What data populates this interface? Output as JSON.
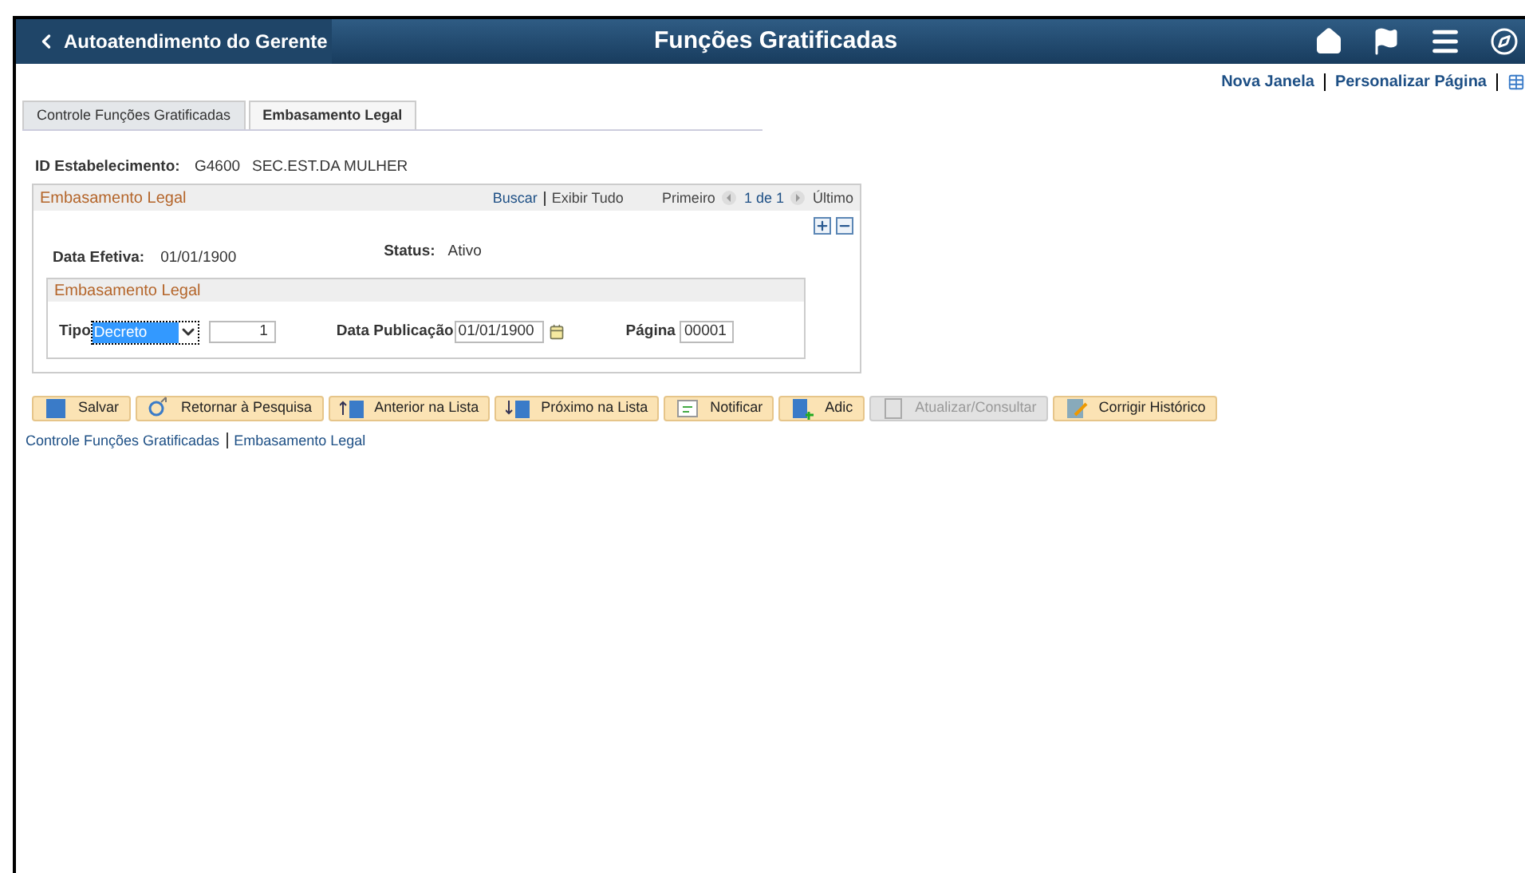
{
  "header": {
    "back_label": "Autoatendimento do Gerente",
    "title": "Funções Gratificadas"
  },
  "top_links": [
    "Nova Janela",
    "Personalizar Página"
  ],
  "tabs": [
    {
      "label": "Controle Funções Gratificadas",
      "selected": false
    },
    {
      "label": "Embasamento Legal",
      "selected": true
    }
  ],
  "establishment": {
    "label": "ID Estabelecimento:",
    "code": "G4600",
    "name": "SEC.EST.DA MULHER"
  },
  "section": {
    "title": "Embasamento Legal",
    "search": "Buscar",
    "show_all": "Exibir Tudo",
    "first": "Primeiro",
    "range": "1 de 1",
    "last": "Último",
    "effective_date_label": "Data Efetiva:",
    "effective_date": "01/01/1900",
    "status_label": "Status:",
    "status": "Ativo",
    "sub_title": "Embasamento Legal",
    "type_label": "Tipo",
    "type_value": "Decreto",
    "number": "1",
    "pub_label": "Data Publicação",
    "pub_date": "01/01/1900",
    "page_label": "Página",
    "page": "00001"
  },
  "buttons": [
    {
      "label": "Salvar",
      "kind": "save",
      "disabled": false
    },
    {
      "label": "Retornar à Pesquisa",
      "kind": "search",
      "disabled": false
    },
    {
      "label": "Anterior na Lista",
      "kind": "prev",
      "disabled": false
    },
    {
      "label": "Próximo na Lista",
      "kind": "next",
      "disabled": false
    },
    {
      "label": "Notificar",
      "kind": "notify",
      "disabled": false
    },
    {
      "label": "Adic",
      "kind": "add",
      "disabled": false
    },
    {
      "label": "Atualizar/Consultar",
      "kind": "view",
      "disabled": true
    },
    {
      "label": "Corrigir Histórico",
      "kind": "edit",
      "disabled": false
    }
  ],
  "bottom_links": [
    "Controle Funções Gratificadas",
    "Embasamento Legal"
  ]
}
